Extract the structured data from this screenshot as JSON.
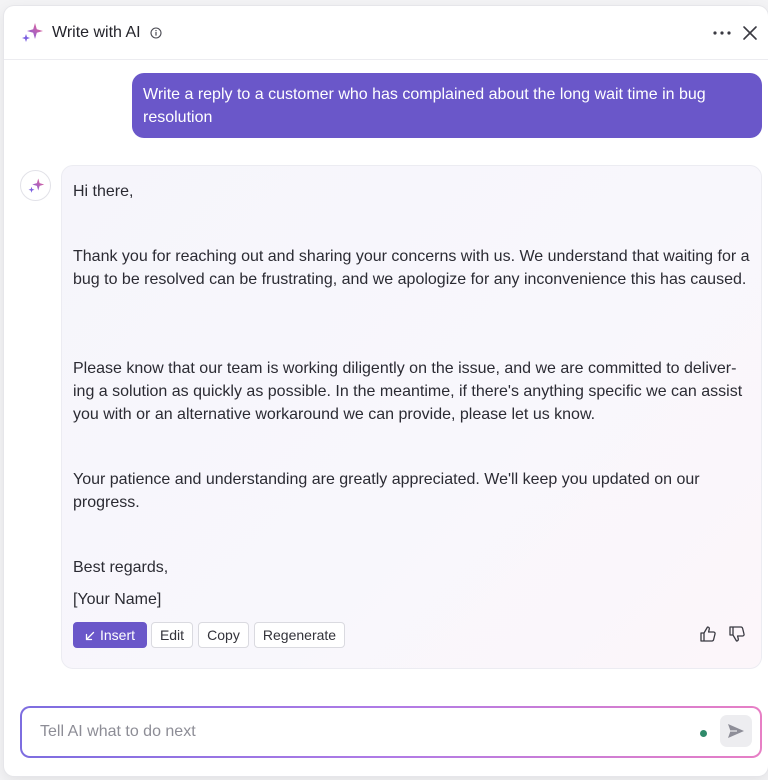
{
  "header": {
    "title": "Write with AI",
    "icon": "sparkle-icon",
    "info_icon": "info-icon",
    "more_icon": "more-horizontal-icon",
    "close_icon": "close-icon"
  },
  "user_message": "Write a reply to a customer who has complained about the long wait time in bug resolution",
  "ai_response": {
    "greeting": "Hi there,",
    "paragraphs": [
      "Thank you for reaching out and sharing your concerns with us. We understand that waiting for a bug to be resolved can be frustrating, and we apologize for any inconvenience this has caused.",
      "Please know that our team is working diligently on the issue, and we are committed to deliver­ing a solution as quickly as possible. In the meantime, if there's anything specific we can as­sist you with or an alternative workaround we can provide, please let us know.",
      "Your patience and understanding are greatly appreciated. We'll keep you updated on our progress."
    ],
    "closing": "Best regards,",
    "signature": "[Your Name]"
  },
  "actions": {
    "insert": "Insert",
    "edit": "Edit",
    "copy": "Copy",
    "regenerate": "Regenerate"
  },
  "input": {
    "placeholder": "Tell AI what to do next"
  },
  "colors": {
    "accent": "#6a57c9",
    "status_dot": "#2f8a6a"
  }
}
